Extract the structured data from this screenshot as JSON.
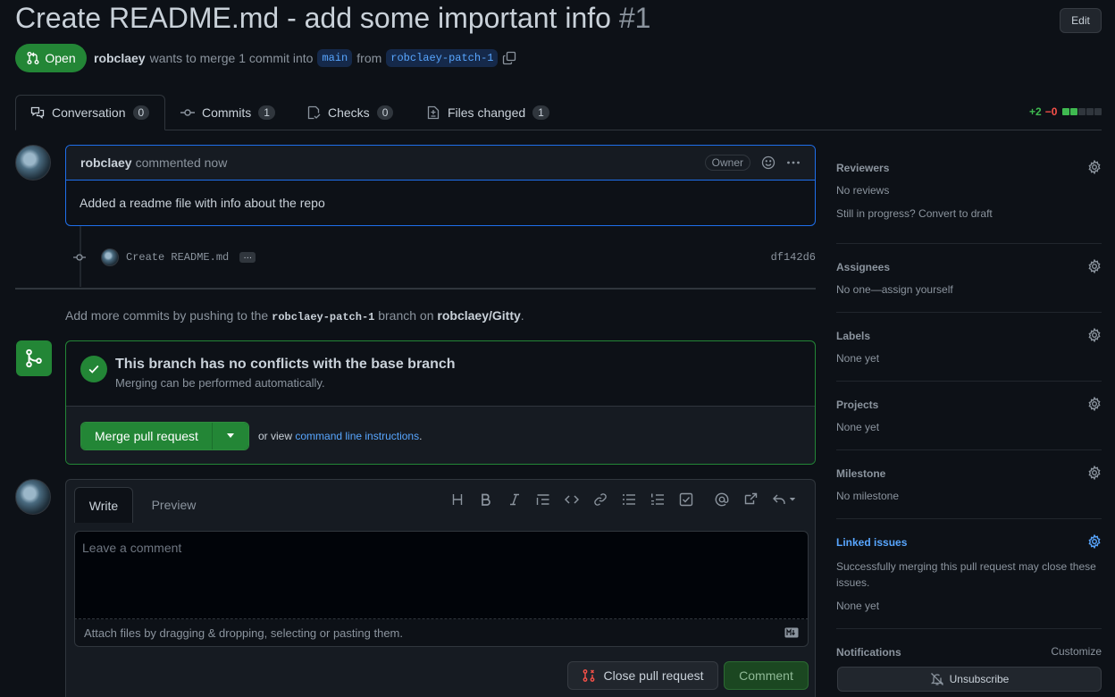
{
  "header": {
    "title": "Create README.md - add some important info",
    "number": "#1",
    "edit_label": "Edit",
    "state_label": "Open",
    "author": "robclaey",
    "merge_text": "wants to merge 1 commit into",
    "base_branch": "main",
    "from_text": "from",
    "head_branch": "robclaey-patch-1"
  },
  "tabs": [
    {
      "label": "Conversation",
      "count": "0"
    },
    {
      "label": "Commits",
      "count": "1"
    },
    {
      "label": "Checks",
      "count": "0"
    },
    {
      "label": "Files changed",
      "count": "1"
    }
  ],
  "diffstat": {
    "additions": "+2",
    "deletions": "−0"
  },
  "comment": {
    "author": "robclaey",
    "time": "commented now",
    "badge": "Owner",
    "body": "Added a readme file with info about the repo"
  },
  "commit": {
    "message": "Create README.md",
    "ellipsis": "…",
    "sha": "df142d6"
  },
  "push_note": {
    "prefix": "Add more commits by pushing to the",
    "branch": "robclaey-patch-1",
    "middle": "branch on",
    "repo": "robclaey/Gitty",
    "suffix": "."
  },
  "merge": {
    "title": "This branch has no conflicts with the base branch",
    "subtitle": "Merging can be performed automatically.",
    "button": "Merge pull request",
    "alt_prefix": "or view",
    "alt_link": "command line instructions",
    "alt_suffix": "."
  },
  "editor": {
    "write_tab": "Write",
    "preview_tab": "Preview",
    "placeholder": "Leave a comment",
    "attach_text": "Attach files by dragging & dropping, selecting or pasting them.",
    "close_button": "Close pull request",
    "comment_button": "Comment"
  },
  "sidebar": {
    "reviewers": {
      "title": "Reviewers",
      "line1": "No reviews",
      "line2": "Still in progress? Convert to draft"
    },
    "assignees": {
      "title": "Assignees",
      "line1": "No one—assign yourself"
    },
    "labels": {
      "title": "Labels",
      "line1": "None yet"
    },
    "projects": {
      "title": "Projects",
      "line1": "None yet"
    },
    "milestone": {
      "title": "Milestone",
      "line1": "No milestone"
    },
    "linked": {
      "title": "Linked issues",
      "line1": "Successfully merging this pull request may close these issues.",
      "line2": "None yet"
    },
    "notifications": {
      "title": "Notifications",
      "customize": "Customize",
      "button": "Unsubscribe"
    }
  },
  "colors": {
    "accent_green": "#238636",
    "link_blue": "#58a6ff",
    "bg": "#0d1117"
  }
}
